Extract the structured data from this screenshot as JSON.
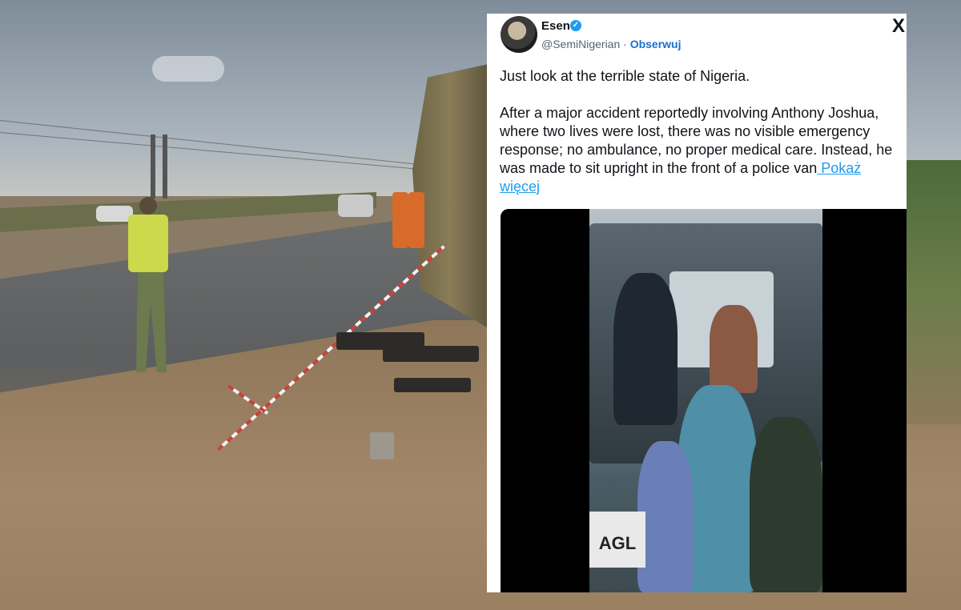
{
  "tweet": {
    "author": {
      "name": "Esen",
      "handle": "@SemiNigerian",
      "separator": "·",
      "follow_label": "Obserwuj",
      "verified": true
    },
    "close_glyph": "X",
    "paragraphs": [
      "Just look at the terrible state of Nigeria.",
      "After a major accident reportedly involving Anthony Joshua, where two lives were lost, there was no visible emergency response; no ambulance, no proper medical care. Instead, he was made to sit upright in the front of a police van"
    ],
    "show_more_label": " Pokaż więcej",
    "video_overlay_text": "AGL"
  },
  "colors": {
    "accent": "#1d9bf0",
    "follow": "#1d6fd1",
    "text": "#0f1419",
    "muted": "#536471"
  }
}
